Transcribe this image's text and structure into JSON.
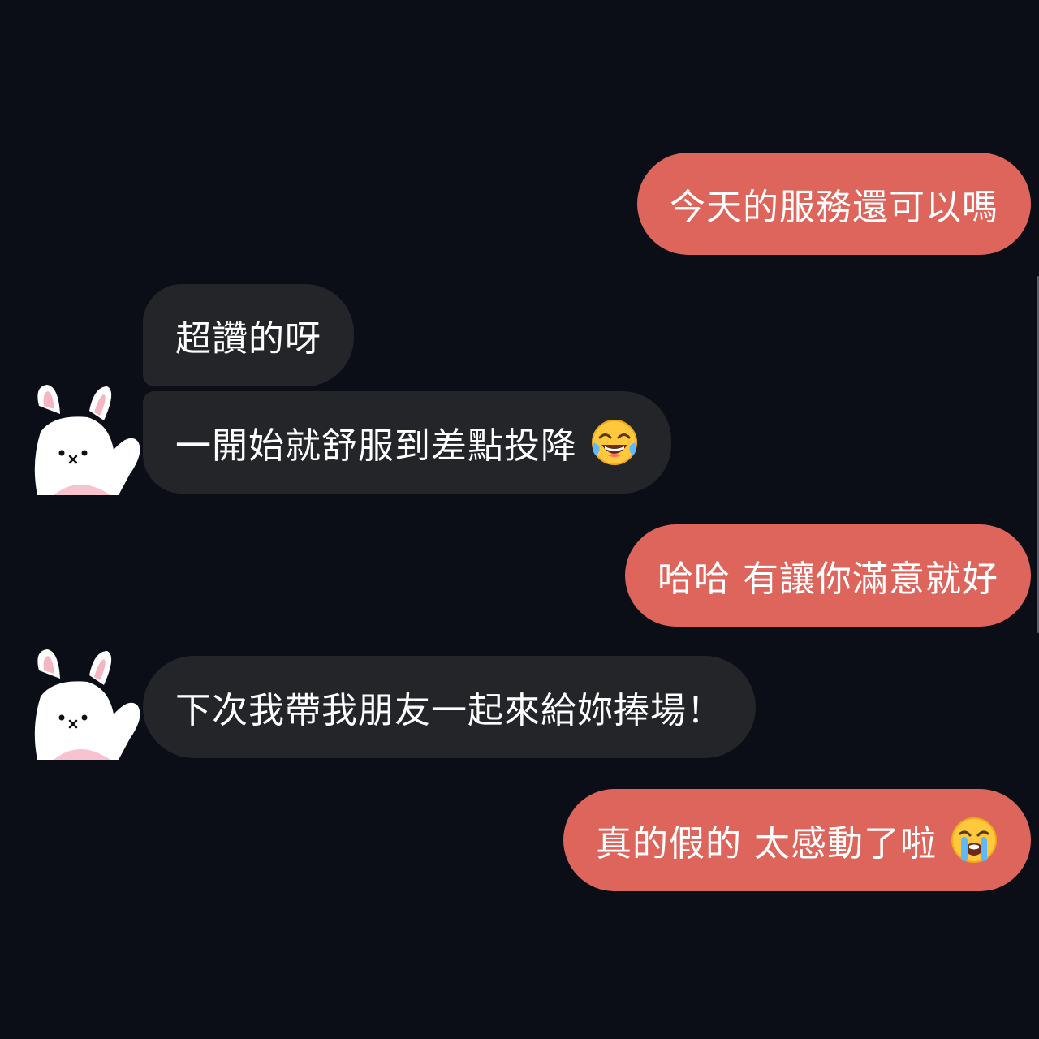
{
  "messages": [
    {
      "side": "out",
      "text": "今天的服務還可以嗎",
      "emoji": ""
    },
    {
      "side": "in",
      "text": "超讚的呀",
      "emoji": ""
    },
    {
      "side": "in",
      "text": "一開始就舒服到差點投降",
      "emoji": "face-with-tears-of-joy"
    },
    {
      "side": "out",
      "text": "哈哈 有讓你滿意就好",
      "emoji": ""
    },
    {
      "side": "in",
      "text": "下次我帶我朋友一起來給妳捧場！",
      "emoji": ""
    },
    {
      "side": "out",
      "text": "真的假的 太感動了啦",
      "emoji": "loudly-crying-face"
    }
  ],
  "avatar": {
    "icon": "white-bunny-waving-icon"
  },
  "colors": {
    "background": "#0b0e16",
    "outgoing_bubble": "#de655c",
    "incoming_bubble": "#232529",
    "text": "#ffffff"
  }
}
